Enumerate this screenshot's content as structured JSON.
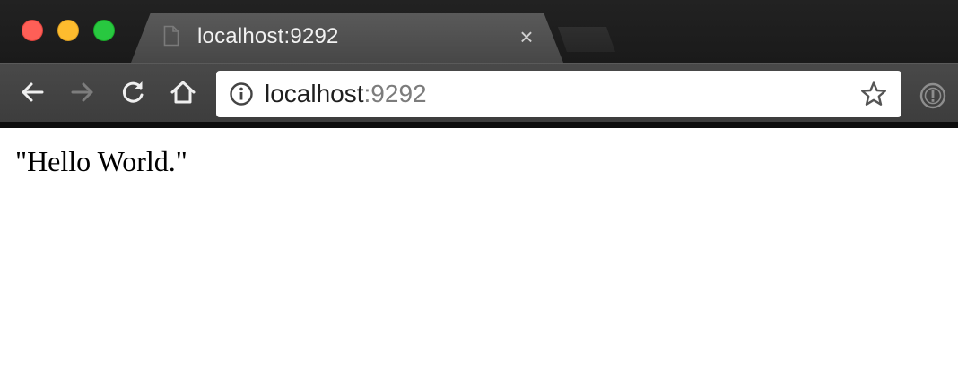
{
  "window": {
    "controls": [
      "close",
      "minimize",
      "maximize"
    ]
  },
  "tabs": [
    {
      "title": "localhost:9292",
      "active": true,
      "favicon": "document-icon",
      "close_glyph": "×"
    }
  ],
  "toolbar": {
    "buttons": [
      "back-arrow-icon",
      "forward-arrow-icon",
      "reload-icon",
      "home-icon"
    ],
    "forward_enabled": false
  },
  "omnibox": {
    "info_icon": "info-circle-icon",
    "url_host": "localhost",
    "url_port": ":9292",
    "bookmark_icon": "star-outline-icon"
  },
  "extensions": {
    "icon": "exclamation-circle-icon"
  },
  "page": {
    "body_text": "\"Hello World.\""
  },
  "colors": {
    "tabstrip": "#1d1d1d",
    "active_tab": "#4f4f4f",
    "toolbar": "#434343",
    "close_light": "#fe5f57",
    "minimize_light": "#febc2e",
    "maximize_light": "#28c840",
    "url_port": "#7c7c7c",
    "page_background": "#ffffff"
  }
}
